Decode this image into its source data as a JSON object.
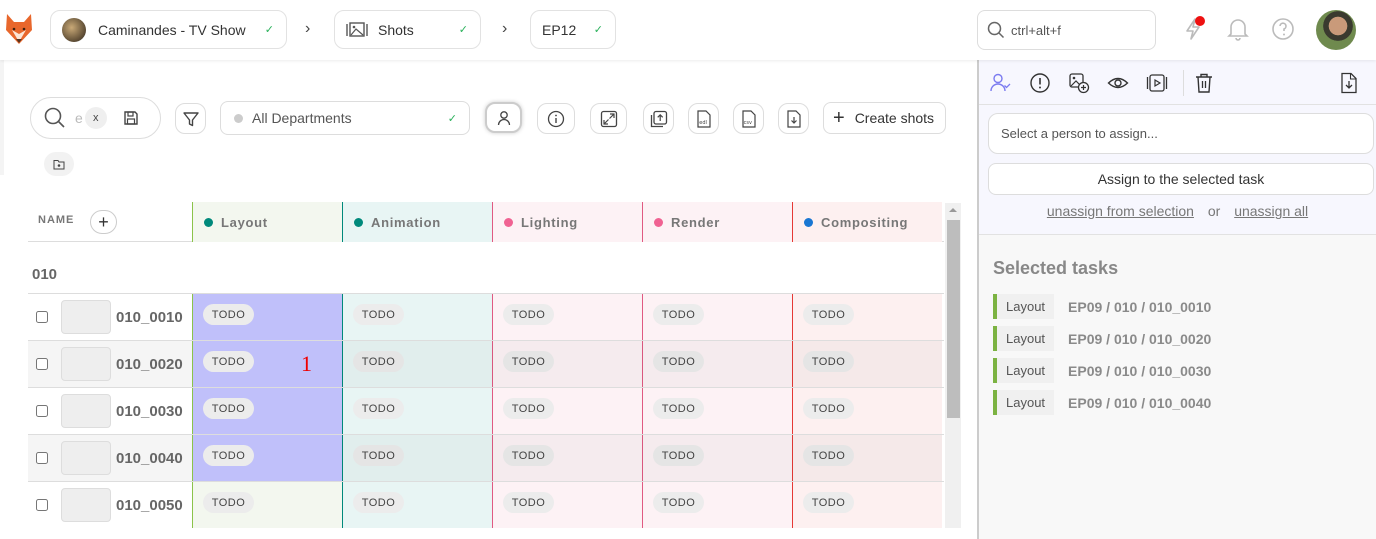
{
  "topbar": {
    "logo": "kitsu-fox-logo",
    "production": "Caminandes - TV Show",
    "section": "Shots",
    "episode": "EP12",
    "search_placeholder": "ctrl+alt+f",
    "icons": [
      "news-lightning-icon",
      "bell-icon",
      "help-icon"
    ],
    "has_notification": true
  },
  "toolbar": {
    "search_value": "e",
    "clear_label": "x",
    "department_filter": "All Departments",
    "create_label": "Create shots"
  },
  "table": {
    "name_header": "NAME",
    "add_column_label": "+",
    "columns": [
      {
        "name": "Layout",
        "dot": "#00897b",
        "line": "#8bc34a",
        "bg": "#f3f7ef"
      },
      {
        "name": "Animation",
        "dot": "#00897b",
        "line": "#00897b",
        "bg": "#e8f5f4"
      },
      {
        "name": "Lighting",
        "dot": "#f06292",
        "line": "#e05a82",
        "bg": "#fdf2f5"
      },
      {
        "name": "Render",
        "dot": "#f06292",
        "line": "#e05a82",
        "bg": "#fdf2f5"
      },
      {
        "name": "Compositing",
        "dot": "#1976d2",
        "line": "#e53935",
        "bg": "#fdf0f0"
      }
    ],
    "group": "010",
    "rows": [
      {
        "name": "010_0010",
        "statuses": [
          "TODO",
          "TODO",
          "TODO",
          "TODO",
          "TODO"
        ],
        "selected": [
          true,
          false,
          false,
          false,
          false
        ]
      },
      {
        "name": "010_0020",
        "statuses": [
          "TODO",
          "TODO",
          "TODO",
          "TODO",
          "TODO"
        ],
        "selected": [
          true,
          false,
          false,
          false,
          false
        ]
      },
      {
        "name": "010_0030",
        "statuses": [
          "TODO",
          "TODO",
          "TODO",
          "TODO",
          "TODO"
        ],
        "selected": [
          true,
          false,
          false,
          false,
          false
        ]
      },
      {
        "name": "010_0040",
        "statuses": [
          "TODO",
          "TODO",
          "TODO",
          "TODO",
          "TODO"
        ],
        "selected": [
          true,
          false,
          false,
          false,
          false
        ]
      },
      {
        "name": "010_0050",
        "statuses": [
          "TODO",
          "TODO",
          "TODO",
          "TODO",
          "TODO"
        ],
        "selected": [
          false,
          false,
          false,
          false,
          false
        ]
      }
    ],
    "selection_marker": "1",
    "selected_color": "#c0c0fa"
  },
  "panel": {
    "person_placeholder": "Select a person to assign...",
    "assign_label": "Assign to the selected task",
    "unassign_selection": "unassign from selection",
    "or_label": "or",
    "unassign_all": "unassign all",
    "selected_title": "Selected tasks",
    "selected_tasks": [
      {
        "type": "Layout",
        "path": "EP09 / 010 / 010_0010"
      },
      {
        "type": "Layout",
        "path": "EP09 / 010 / 010_0020"
      },
      {
        "type": "Layout",
        "path": "EP09 / 010 / 010_0030"
      },
      {
        "type": "Layout",
        "path": "EP09 / 010 / 010_0040"
      }
    ]
  }
}
